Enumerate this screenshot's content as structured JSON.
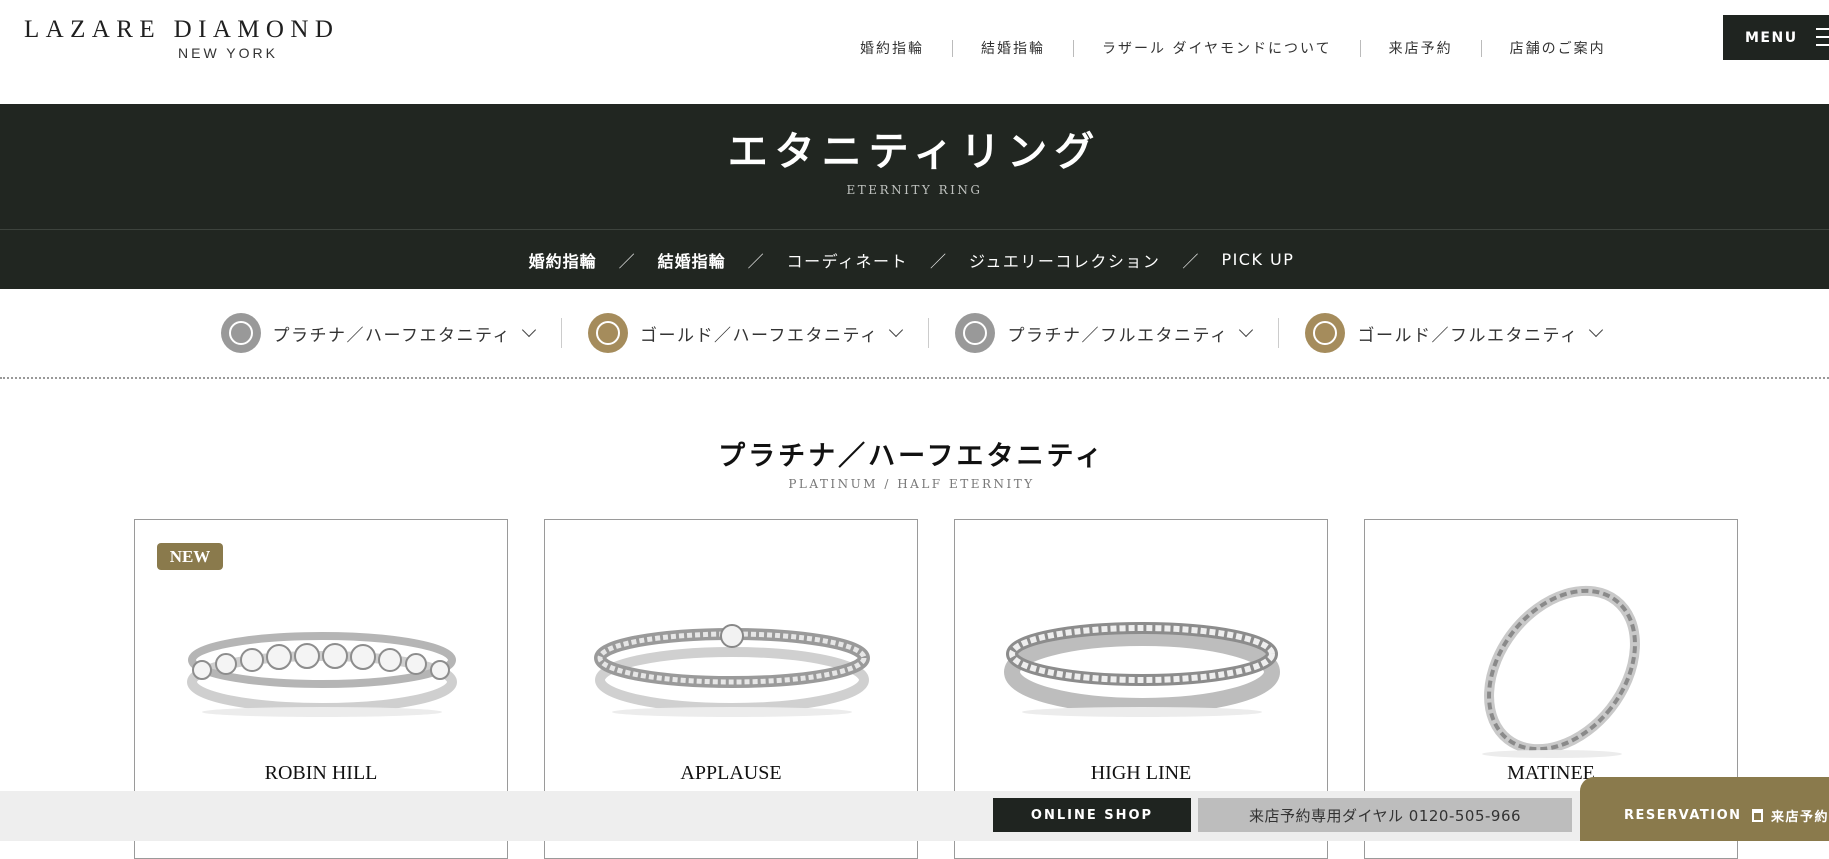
{
  "header": {
    "logo_main": "LAZARE DIAMOND",
    "logo_sub": "NEW YORK",
    "nav": [
      "婚約指輪",
      "結婚指輪",
      "ラザール ダイヤモンドについて",
      "来店予約",
      "店舗のご案内"
    ],
    "menu_label": "MENU"
  },
  "hero": {
    "title": "エタニティリング",
    "subtitle": "ETERNITY RING"
  },
  "subnav": {
    "items": [
      "婚約指輪",
      "結婚指輪",
      "コーディネート",
      "ジュエリーコレクション",
      "PICK UP"
    ],
    "separator": "／"
  },
  "filters": [
    {
      "label": "プラチナ／ハーフエタニティ",
      "icon": "platinum-ring-icon",
      "color": "#999999"
    },
    {
      "label": "ゴールド／ハーフエタニティ",
      "icon": "gold-ring-icon",
      "color": "#a58c5c"
    },
    {
      "label": "プラチナ／フルエタニティ",
      "icon": "platinum-ring-icon",
      "color": "#999999"
    },
    {
      "label": "ゴールド／フルエタニティ",
      "icon": "gold-ring-icon",
      "color": "#a58c5c"
    }
  ],
  "section": {
    "title": "プラチナ／ハーフエタニティ",
    "subtitle": "PLATINUM / HALF ETERNITY"
  },
  "products": [
    {
      "name": "ROBIN HILL",
      "badge": "NEW"
    },
    {
      "name": "APPLAUSE",
      "badge": ""
    },
    {
      "name": "HIGH LINE",
      "badge": ""
    },
    {
      "name": "MATINEE",
      "badge": ""
    }
  ],
  "footer_bar": {
    "online_shop": "ONLINE SHOP",
    "tel": "来店予約専用ダイヤル 0120-505-966",
    "reservation_en": "RESERVATION",
    "reservation_jp": "来店予約"
  },
  "colors": {
    "dark": "#212621",
    "gold": "#8a7a4c",
    "platinum": "#999999"
  }
}
